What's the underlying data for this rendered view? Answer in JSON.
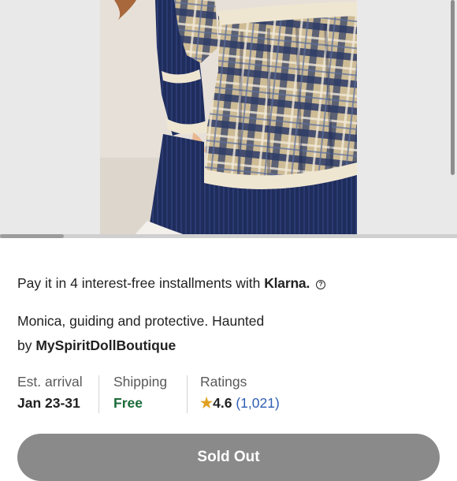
{
  "gallery": {
    "image_subject": "doll in blue and tan plaid dress with lace trim",
    "scroll_progress": 0.14
  },
  "payment": {
    "prefix": "Pay it in 4 interest-free installments with",
    "provider": "Klarna.",
    "help_icon": "help-circle-icon"
  },
  "product": {
    "title": "Monica, guiding and protective. Haunted",
    "seller_prefix": "by",
    "seller_name": "MySpiritDollBoutique"
  },
  "stats": {
    "arrival": {
      "label": "Est. arrival",
      "value": "Jan 23-31"
    },
    "shipping": {
      "label": "Shipping",
      "value": "Free"
    },
    "ratings": {
      "label": "Ratings",
      "score": "4.6",
      "count": "(1,021)",
      "icon": "star-icon"
    }
  },
  "actions": {
    "sold_out_label": "Sold Out"
  },
  "colors": {
    "free_green": "#1b6b39",
    "rating_link": "#2f5fb3",
    "star": "#e0a021",
    "button_disabled": "#8a8a8a"
  }
}
